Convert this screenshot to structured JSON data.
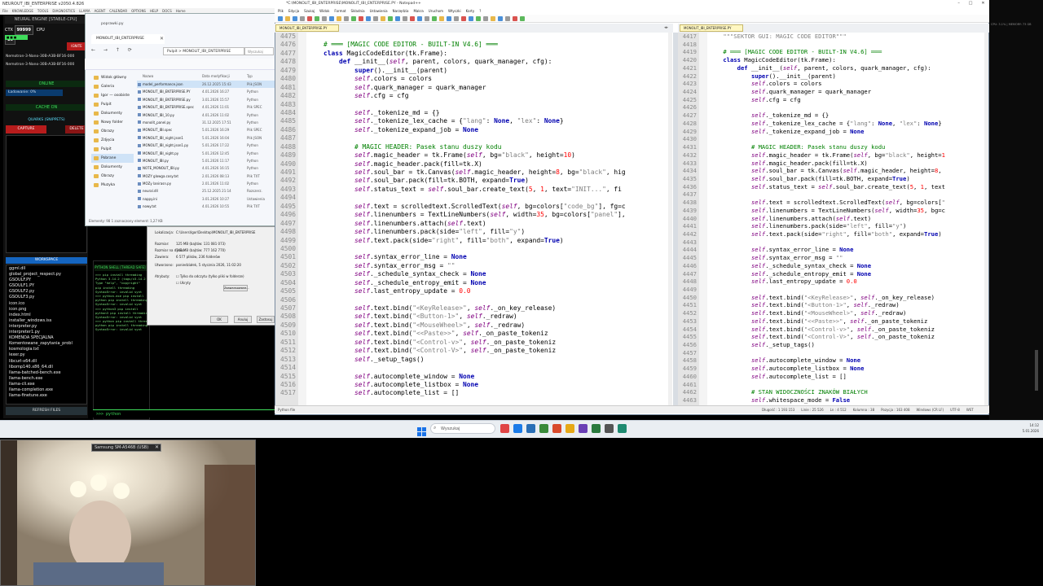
{
  "neural": {
    "titlebar": "NEUROUT_IBI_ENTERPRISE v2050.4.826",
    "menu": [
      "File",
      "KNOWLEDGE",
      "TOOLS",
      "DIAGNOSTICS",
      "LLAMA",
      "AGENT",
      "CALENDAR",
      "OPTIONS",
      "HELP",
      "DOCS",
      "Home"
    ],
    "header": "NEURAL ENGINE [STABLE-CPU]",
    "ctx_label": "CTX",
    "ctx_value": "99999",
    "cpu_label": "CPU",
    "cpu_value": "16",
    "ignite": "IGNITE",
    "models": [
      "Nemotron-3-Nano-30B-A3B-BF16-000",
      "Nemotron-3-Nano-30B-A3B-BF16-000"
    ],
    "online": "ONLINE",
    "loading": "Ładowanie: 0%",
    "cache": "CACHE ON",
    "quarks": "QUARKS (SNIPPETS)",
    "capture": "CAPTURE",
    "delete": "DELETE",
    "workspace": "WORKSPACE",
    "files": [
      "ggml.dll",
      "global_project_respect.py",
      "GSOULF.PY",
      "GSOULF1.PY",
      "GSOULF2.py",
      "GSOULF3.py",
      "icon.ico",
      "icon.png",
      "index.html",
      "installer_windows.iss",
      "interpreter.py",
      "interpreter1.py",
      "KOMENDA SPECJALNA",
      "Komentowane_zapytania_probl",
      "kosmologia.txt",
      "lexer.py",
      "libcurl-x64.dll",
      "libomp140.x86_64.dll",
      "llama-batched-bench.exe",
      "llama-bench.exe",
      "llama-cli.exe",
      "llama-completion.exe",
      "llama-finetune.exe"
    ],
    "refresh": "REFRESH FILES"
  },
  "pyshell": {
    "title": "PYTHON SHELL [THREAD SAFE]",
    "lines": [
      ">>> pip install threading",
      "Python 3.14.2 (tags/v3.14.2",
      "Type \"help\", \"copyright\"",
      "pip install threading",
      "SyntaxError: invalid synt",
      ">>> python.exe pip install",
      "python pip install threading",
      "SyntaxError: invalid synt",
      ">>> python3 pip install",
      "python3 pip install threading",
      "SyntaxError: invalid synt",
      ">>> python pip install threading",
      "python pip install threading",
      "SyntaxError: invalid synt"
    ],
    "prompt": ">>> python"
  },
  "explorer": {
    "tab": "MONOLIT_IBI_ENTERPRISE",
    "tab_alt": "poprawki.py",
    "address": "Pulpit  >  MONOLIT_IBI_ENTERPRISE",
    "search": "Wyszukaj",
    "nav": [
      "Widok główny",
      "Galeria",
      "Igor — osobiste",
      "Pulpit",
      "Dokumenty",
      "Nowy folder",
      "Obrazy",
      "Zdjęcia",
      "Pulpit",
      "Pobrane",
      "Dokumenty",
      "Obrazy",
      "Muzyka"
    ],
    "headers": [
      "Nazwa",
      "Data modyfikacji",
      "Typ"
    ],
    "rows": [
      {
        "name": "model_performance.json",
        "date": "26.12.2025 15:43",
        "type": "Plik JSON"
      },
      {
        "name": "MONOLIT_IBI_ENTERPRISE.PY",
        "date": "4.01.2026 16:27",
        "type": "Python"
      },
      {
        "name": "MONOLIT_IBI_ENTERPRISE.py",
        "date": "3.01.2026 15:57",
        "type": "Python"
      },
      {
        "name": "MONOLIT_IBI_ENTERPRISE.spec",
        "date": "4.01.2026 11:01",
        "type": "Plik SPEC"
      },
      {
        "name": "MONOLIT_IBI_10.py",
        "date": "4.01.2026 11:02",
        "type": "Python"
      },
      {
        "name": "monolit_panel.py",
        "date": "31.12.2025 17:51",
        "type": "Python"
      },
      {
        "name": "MONOLIT_IBI.spec",
        "date": "5.01.2026 16:29",
        "type": "Plik SPEC"
      },
      {
        "name": "MONOLIT_IBI_night.json1",
        "date": "5.01.2026 16:04",
        "type": "Plik JSON"
      },
      {
        "name": "MONOLIT_IBI_night.json1.py",
        "date": "5.01.2026 17:22",
        "type": "Python"
      },
      {
        "name": "MONOLIT_IBI_night.py",
        "date": "5.01.2026 12:45",
        "type": "Python"
      },
      {
        "name": "MONOLIT_IBI.py",
        "date": "5.01.2026 11:17",
        "type": "Python"
      },
      {
        "name": "NOTE_MONOLIT_IBI.py",
        "date": "4.01.2026 16:15",
        "type": "Python"
      },
      {
        "name": "MOZY glowga.cosy.txt",
        "date": "2.01.2026 08:13",
        "type": "Plik TXT"
      },
      {
        "name": "MOZy lanirasn.py",
        "date": "2.01.2026 11:02",
        "type": "Python"
      },
      {
        "name": "neural.dll",
        "date": "25.12.2025 21:14",
        "type": "Rozszerz."
      },
      {
        "name": "nappy.ini",
        "date": "3.01.2026 10:27",
        "type": "Ustawienia"
      },
      {
        "name": "nowy.txt",
        "date": "4.01.2026 10:55",
        "type": "Plik TXT"
      }
    ],
    "status": "Elementy: 98   1 zaznaczony element: 1,27 KB"
  },
  "properties": {
    "rows": [
      {
        "label": "Lokalizacja:",
        "value": "C:\\Users\\Igor\\Desktop\\MONOLIT_IBI_ENTERPRISE"
      },
      {
        "label": "Rozmiar:",
        "value": "125 MB (bajtów: 131 081 073)"
      },
      {
        "label": "Rozmiar na dysku:",
        "value": "743 MB (bajtów: 777 162 770)"
      },
      {
        "label": "Zawiera:",
        "value": "6 577 plików, 236 folderów"
      },
      {
        "label": "Utworzono:",
        "value": "poniedziałek, 5 stycznia 2026, 11:02:20"
      },
      {
        "label": "Atrybuty:",
        "value": "Tylko do odczytu (tylko pliki w folderze)"
      },
      {
        "label": "",
        "value": "Ukryty"
      }
    ],
    "advanced": "Zaawansowane...",
    "ok": "OK",
    "cancel": "Anuluj",
    "apply": "Zastosuj"
  },
  "notepad": {
    "title": "*C:\\MONOLIT_IBI_ENTERPRISE\\MONOLIT_IBI_ENTERPRISE.PY - Notepad++",
    "menu": [
      "Plik",
      "Edycja",
      "Szukaj",
      "Widok",
      "Format",
      "Składnia",
      "Ustawienia",
      "Narzędzia",
      "Makra",
      "Uruchom",
      "Wtyczki",
      "Karty",
      "?"
    ],
    "tab_left": "MONOLIT_IBI_ENTERPRISE.PY",
    "tab_right": "MONOLIT_IBI_ENTERPRISE.PY",
    "status_left": "Python file",
    "status_right": [
      "Długość : 1 193 153",
      "Linie : 25 526",
      "Ln : 4 512",
      "Kolumna : 38",
      "Pozycja : 163 408",
      "Windows (CR LF)",
      "UTF-8",
      "WST"
    ],
    "left_lines": [
      "4475",
      "4476",
      "4477",
      "4478",
      "4479",
      "4480",
      "4481",
      "4482",
      "4483",
      "4484",
      "4485",
      "4486",
      "4487",
      "4488",
      "4489",
      "4490",
      "4491",
      "4492",
      "4493",
      "4494",
      "4495",
      "4496",
      "4497",
      "4498",
      "4499",
      "4500",
      "4501",
      "4502",
      "4503",
      "4504",
      "4505",
      "4506",
      "4507",
      "4508",
      "4509",
      "4510",
      "4511",
      "4512",
      "4513",
      "4514",
      "4515",
      "4516",
      "4517"
    ],
    "right_lines": [
      "4417",
      "4418",
      "4419",
      "4420",
      "4421",
      "4422",
      "4423",
      "4424",
      "4425",
      "4426",
      "4427",
      "4428",
      "4429",
      "4430",
      "4431",
      "4432",
      "4433",
      "4434",
      "4435",
      "4436",
      "4437",
      "4438",
      "4439",
      "4440",
      "4441",
      "4442",
      "4443",
      "4444",
      "4445",
      "4446",
      "4447",
      "4448",
      "4449",
      "4450",
      "4451",
      "4452",
      "4453",
      "4454",
      "4455",
      "4456",
      "4457",
      "4458",
      "4459",
      "4460",
      "4461",
      "4462",
      "4463"
    ]
  },
  "taskbar": {
    "search": "Wyszukaj",
    "time": "14:12",
    "date": "5.01.2026"
  },
  "webcam": {
    "device": "Samsung SM-A546B (USB)"
  },
  "right_strip": {
    "header": "CPU: 3.1% | MEMORY: 73 GB"
  },
  "colors": {
    "keyword": "#0000b0",
    "comment": "#008000",
    "string": "#808080",
    "accent_red": "#b71c1c",
    "accent_green": "#3fdc5b",
    "accent_blue": "#1565c0"
  }
}
